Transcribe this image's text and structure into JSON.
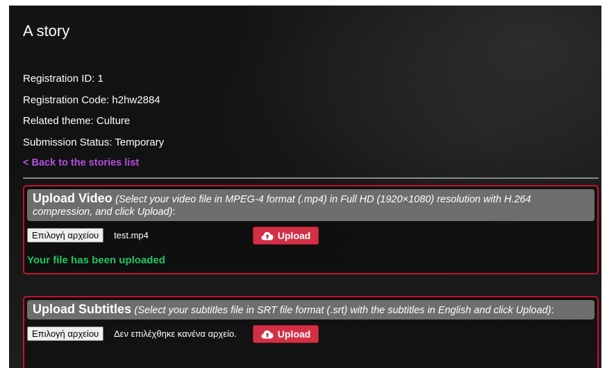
{
  "page": {
    "title": "A story",
    "registration_id": "Registration ID: 1",
    "registration_code": "Registration Code: h2hw2884",
    "related_theme": "Related theme: Culture",
    "submission_status": "Submission Status: Temporary",
    "back_link": "< Back to the stories list"
  },
  "video_upload": {
    "heading": "Upload Video",
    "hint": "(Select your video file in MPEG-4 format (.mp4) in Full HD (1920×1080) resolution with H.264 compression, and click Upload)",
    "colon": ":",
    "file_button": "Επιλογή αρχείου",
    "file_name": "test.mp4",
    "upload_label": "Upload",
    "upload_icon": "cloud-upload-icon",
    "status": "Your file has been uploaded"
  },
  "subtitles_upload": {
    "heading": "Upload Subtitles",
    "hint": "(Select your subtitles file in SRT file format (.srt) with the subtitles in English and click Upload)",
    "colon": ":",
    "file_button": "Επιλογή αρχείου",
    "file_name": "Δεν επιλέχθηκε κανένα αρχείο.",
    "upload_label": "Upload",
    "upload_icon": "cloud-upload-icon"
  },
  "colors": {
    "accent_red": "#d32f45",
    "border_red": "#c8102e",
    "link_purple": "#b34fe0",
    "success_green": "#21c462"
  }
}
